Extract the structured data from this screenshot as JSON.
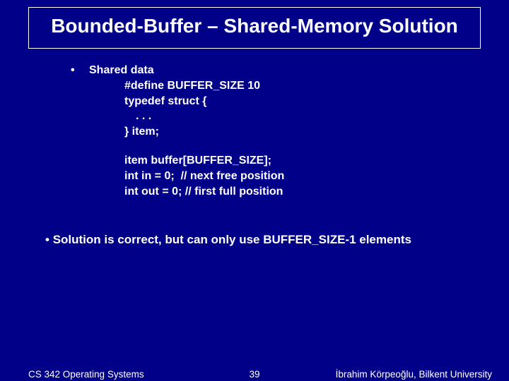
{
  "title": "Bounded-Buffer – Shared-Memory Solution",
  "bullet_label": "Shared data",
  "code": {
    "l1": "#define BUFFER_SIZE 10",
    "l2": "typedef struct {",
    "l3": ". . .",
    "l4": "} item;",
    "l5": "item buffer[BUFFER_SIZE];",
    "l6": "int in = 0;  // next free position",
    "l7": "int out = 0; // first full position"
  },
  "note_bullet": "• ",
  "note_text": "Solution is correct, but can only use BUFFER_SIZE-1 elements",
  "footer": {
    "left": "CS 342 Operating Systems",
    "center": "39",
    "right": "İbrahim Körpeoğlu, Bilkent University"
  }
}
